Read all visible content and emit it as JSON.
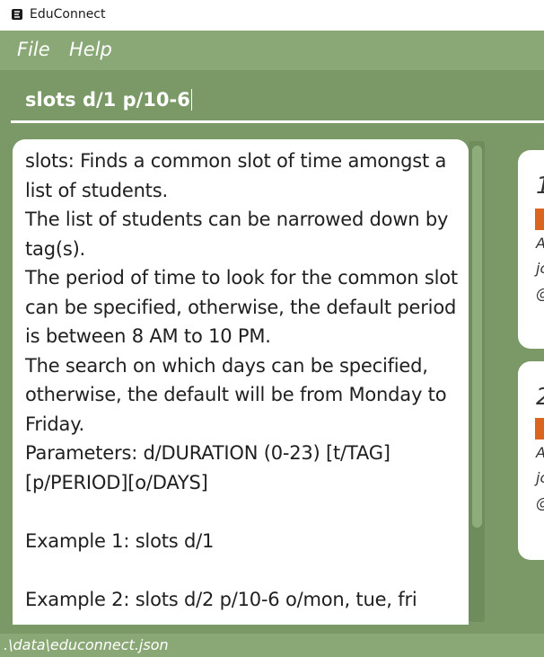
{
  "window": {
    "title": "EduConnect"
  },
  "menu": {
    "items": [
      {
        "label": "File"
      },
      {
        "label": "Help"
      }
    ]
  },
  "command": {
    "value": "slots d/1 p/10-6"
  },
  "result": {
    "text": "slots: Finds a common slot of time amongst a list of students.\nThe list of students can be narrowed down by tag(s).\nThe period of time to look for the common slot can be specified, otherwise, the default period is between 8 AM to 10 PM.\nThe search on which days can be specified, otherwise, the default will be from Monday to Friday.\nParameters: d/DURATION (0-23) [t/TAG][p/PERIOD][o/DAYS]\n\nExample 1: slots d/1\n\nExample 2: slots d/2 p/10-6 o/mon, tue, fri"
  },
  "cards": [
    {
      "index": "1",
      "lines": [
        "A",
        "jc",
        "@"
      ]
    },
    {
      "index": "2",
      "lines": [
        "A",
        "jc",
        "@"
      ]
    }
  ],
  "status": {
    "path": ".\\data\\educonnect.json"
  },
  "colors": {
    "accent": "#8aa876",
    "main_bg": "#7a9966",
    "tag": "#d9651f"
  }
}
